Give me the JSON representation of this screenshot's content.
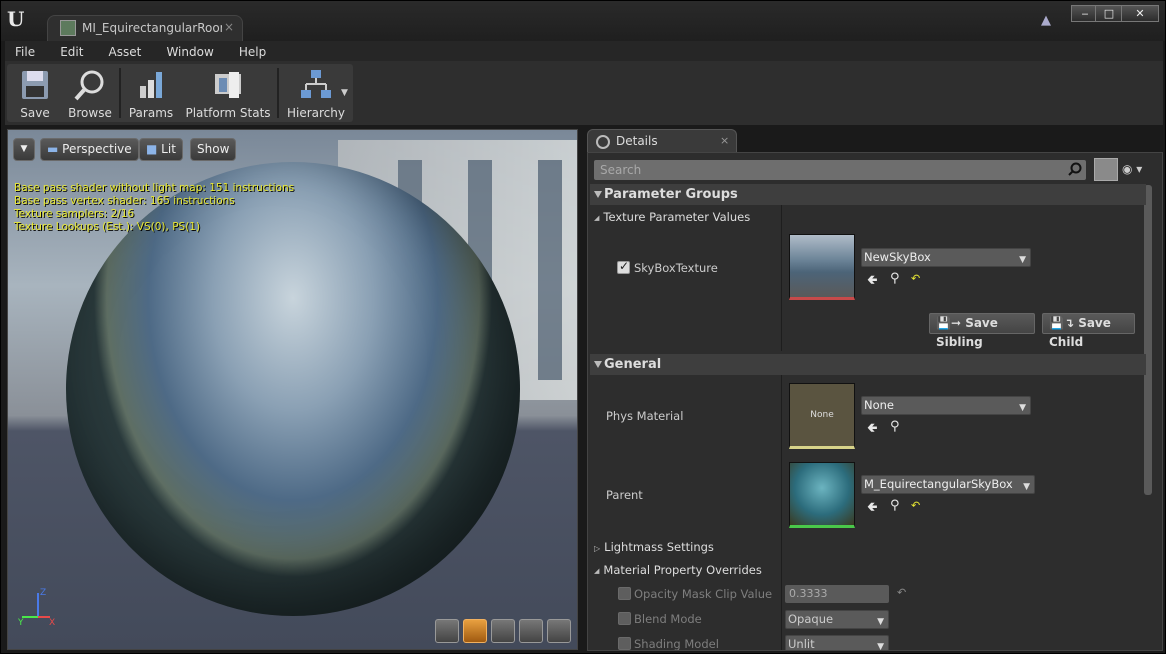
{
  "window": {
    "tab_title": "MI_EquirectangularRoom!",
    "tab_close": "×",
    "minimize": "‒",
    "maximize": "□",
    "close": "✕"
  },
  "menu": [
    "File",
    "Edit",
    "Asset",
    "Window",
    "Help"
  ],
  "toolbar": {
    "save": "Save",
    "browse": "Browse",
    "params": "Params",
    "platform_stats": "Platform Stats",
    "hierarchy": "Hierarchy"
  },
  "viewport": {
    "perspective": "Perspective",
    "lit": "Lit",
    "show": "Show",
    "stats": [
      "Base pass shader without light map: 151 instructions",
      "Base pass vertex shader: 165 instructions",
      "Texture samplers: 2/16",
      "Texture Lookups (Est.): VS(0), PS(1)"
    ],
    "axis_z": "Z",
    "axis_x": "X",
    "axis_y": "Y"
  },
  "details": {
    "tab": "Details",
    "tab_close": "×",
    "search_placeholder": "Search",
    "parameter_groups": "Parameter Groups",
    "texture_param_values": "Texture Parameter Values",
    "skybox_label": "SkyBoxTexture",
    "skybox_value": "NewSkyBox",
    "save_sibling": "Save Sibling",
    "save_child": "Save Child",
    "general": "General",
    "phys_material_label": "Phys Material",
    "phys_material_thumb": "None",
    "phys_material_value": "None",
    "parent_label": "Parent",
    "parent_value": "M_EquirectangularSkyBox",
    "lightmass": "Lightmass Settings",
    "material_overrides": "Material Property Overrides",
    "opacity_label": "Opacity Mask Clip Value",
    "opacity_value": "0.3333",
    "blend_label": "Blend Mode",
    "blend_value": "Opaque",
    "shading_label": "Shading Model",
    "shading_value": "Unlit"
  },
  "colors": {
    "stats_text": "#e8e834",
    "texture_bar_red": "#c84a4a",
    "parent_bar_green": "#4ac84a",
    "phys_bar_yellow": "#d8d48a"
  }
}
